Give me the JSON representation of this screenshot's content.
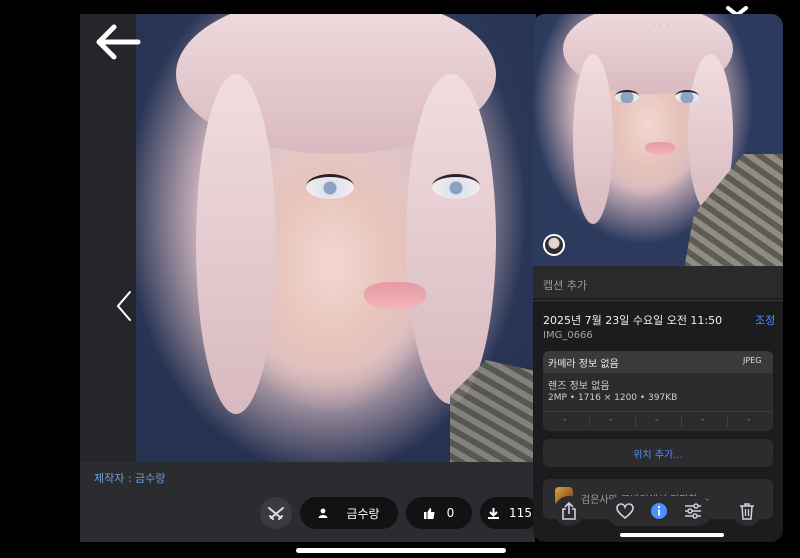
{
  "background_app": {
    "creator_label": "제작자 : 금수랑",
    "author_name": "금수랑",
    "like_count": "0",
    "download_count": "115"
  },
  "info_panel": {
    "caption_placeholder": "캡션 추가",
    "date": "2025년 7월 23일 수요일 오전 11:50",
    "adjust_label": "조정",
    "filename": "IMG_0666",
    "camera_label": "카메라 정보 없음",
    "format": "JPEG",
    "lens": "렌즈 정보 없음",
    "specs": "2MP • 1716 × 1200 • 397KB",
    "exif_dashes": [
      "-",
      "-",
      "-",
      "-",
      "-"
    ],
    "location_button": "위치 추가...",
    "suggestion_text": "검은사막 모바일에서 저장한 >"
  },
  "colors": {
    "accent_blue": "#4a90ff",
    "creator_blue": "#6f9fe0",
    "panel_bg": "#1c1c1e"
  },
  "icons": [
    "back-arrow-icon",
    "chevron-left-icon",
    "close-icon",
    "crossed-guns-icon",
    "person-icon",
    "thumbs-up-icon",
    "download-icon",
    "share-icon",
    "heart-icon",
    "info-icon",
    "sliders-icon",
    "trash-icon"
  ]
}
